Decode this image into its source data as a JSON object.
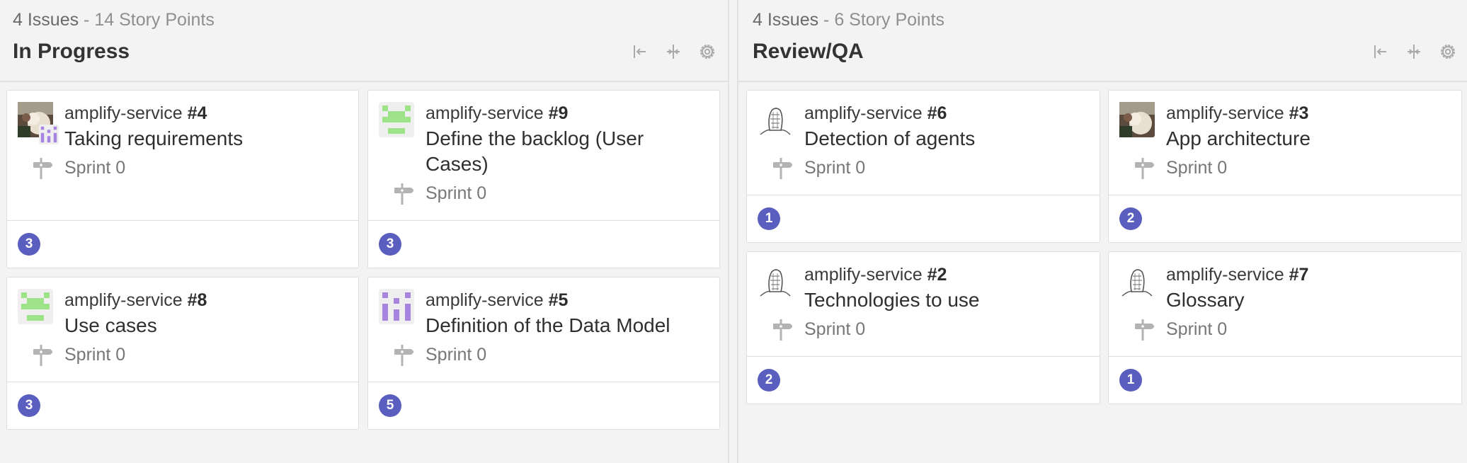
{
  "columns": [
    {
      "issues_label": "4 Issues",
      "separator": " - ",
      "points_label": "14 Story Points",
      "title": "In Progress"
    },
    {
      "issues_label": "4 Issues",
      "separator": " - ",
      "points_label": "6 Story Points",
      "title": "Review/QA"
    }
  ],
  "cards": [
    {
      "repo": "amplify-service",
      "number": "#4",
      "title": "Taking requirements",
      "sprint": "Sprint 0",
      "points": "3",
      "avatar": "photo-avatar"
    },
    {
      "repo": "amplify-service",
      "number": "#9",
      "title": "Define the backlog (User Cases)",
      "sprint": "Sprint 0",
      "points": "3",
      "avatar": "green-identicon-avatar"
    },
    {
      "repo": "amplify-service",
      "number": "#8",
      "title": "Use cases",
      "sprint": "Sprint 0",
      "points": "3",
      "avatar": "green-identicon-avatar"
    },
    {
      "repo": "amplify-service",
      "number": "#5",
      "title": "Definition of the Data Model",
      "sprint": "Sprint 0",
      "points": "5",
      "avatar": "purple-identicon-avatar"
    },
    {
      "repo": "amplify-service",
      "number": "#6",
      "title": "Detection of agents",
      "sprint": "Sprint 0",
      "points": "1",
      "avatar": "sketch-avatar"
    },
    {
      "repo": "amplify-service",
      "number": "#3",
      "title": "App architecture",
      "sprint": "Sprint 0",
      "points": "2",
      "avatar": "photo-avatar"
    },
    {
      "repo": "amplify-service",
      "number": "#2",
      "title": "Technologies to use",
      "sprint": "Sprint 0",
      "points": "2",
      "avatar": "sketch-avatar"
    },
    {
      "repo": "amplify-service",
      "number": "#7",
      "title": "Glossary",
      "sprint": "Sprint 0",
      "points": "1",
      "avatar": "sketch-avatar"
    }
  ],
  "icons": {
    "collapse": "collapse-left-icon",
    "expand": "expand-columns-icon",
    "settings": "gear-icon",
    "milestone": "milestone-signpost-icon"
  },
  "colors": {
    "badge": "#5a5fbf",
    "identicon_green": "#9ee28a",
    "identicon_purple": "#a784e0"
  }
}
